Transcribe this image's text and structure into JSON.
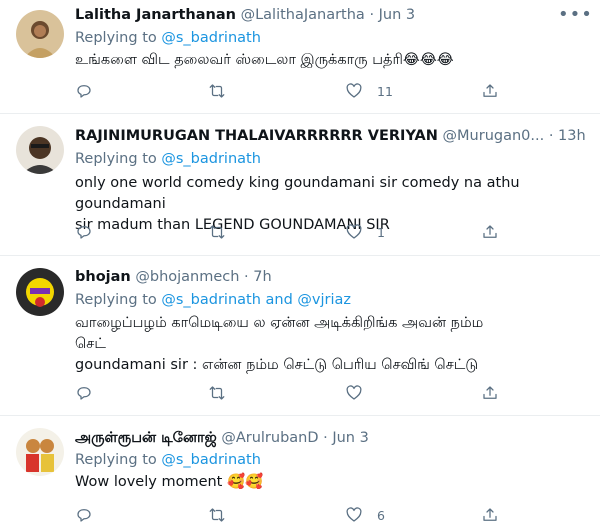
{
  "tweets": [
    {
      "name": "Lalitha Janarthanan",
      "handle": "@LalithaJanartha",
      "time": "Jun 3",
      "replying_prefix": "Replying to",
      "replying_to": "@s_badrinath",
      "text_lines": [
        "உங்களை விட தலைவர் ஸ்டைலா இருக்காரு பத்ரி😂😂😂"
      ],
      "likes": "11"
    },
    {
      "name": "RAJINIMURUGAN THALAIVARRRRRR VERIYAN",
      "handle": "@Murugan0...",
      "time": "13h",
      "replying_prefix": "Replying to",
      "replying_to": "@s_badrinath",
      "text_lines": [
        "only one world comedy king goundamani sir comedy na athu goundamani",
        "sir madum than LEGEND GOUNDAMANI SIR"
      ],
      "likes": "1"
    },
    {
      "name": "bhojan",
      "handle": "@bhojanmech",
      "time": "7h",
      "replying_prefix": "Replying to",
      "replying_to": "@s_badrinath",
      "replying_and": "and",
      "replying_to_2": "@vjriaz",
      "text_lines": [
        "வாழைப்பழம் காமெடியை ல ஏன்ன அடிக்கிறிங்க அவன் நம்ம",
        "செட்",
        "goundamani sir : என்ன நம்ம செட்டு பெரிய செவிங் செட்டு"
      ],
      "likes": ""
    },
    {
      "name": "அருள்ரூபன் டினோஜ்",
      "handle": "@ArulrubanD",
      "time": "Jun 3",
      "replying_prefix": "Replying to",
      "replying_to": "@s_badrinath",
      "text_lines": [
        "Wow lovely moment 🥰🥰"
      ],
      "likes": "6"
    }
  ],
  "dot_separator": "·",
  "more_glyph": "•••",
  "icons": [
    "reply-icon",
    "retweet-icon",
    "like-icon",
    "share-icon",
    "more-icon"
  ],
  "colors": {
    "link": "#1b95e0",
    "secondary": "#5b7083",
    "text": "#0f1419",
    "divider": "#ebeef0"
  }
}
